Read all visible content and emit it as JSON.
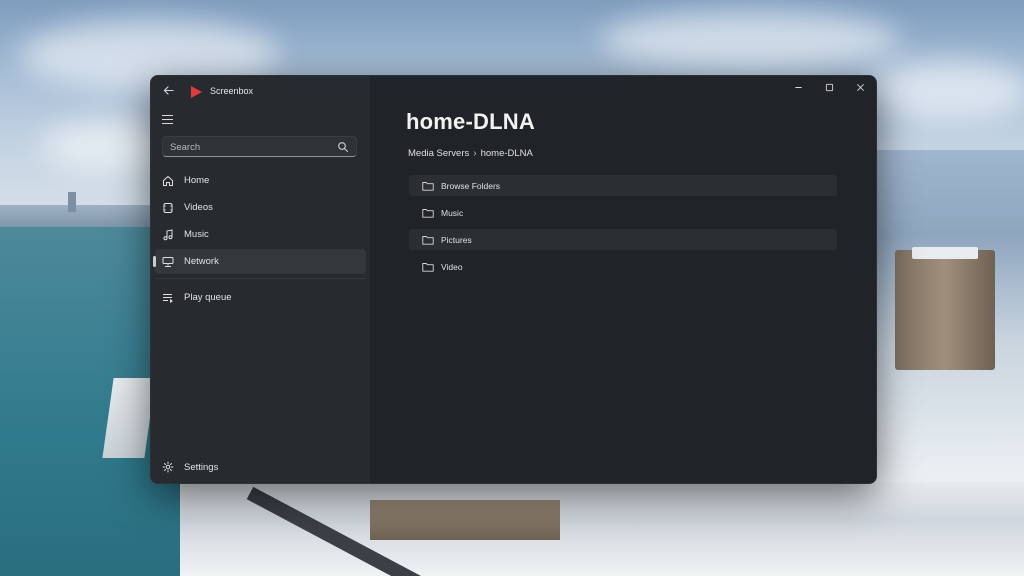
{
  "app": {
    "title": "Screenbox",
    "logo_color": "#e23a3a",
    "window_controls": [
      "minimize-icon",
      "maximize-icon",
      "close-icon"
    ]
  },
  "search": {
    "placeholder": "Search",
    "value": ""
  },
  "sidebar": {
    "items": [
      {
        "label": "Home",
        "icon": "home-icon",
        "active": false
      },
      {
        "label": "Videos",
        "icon": "video-icon",
        "active": false
      },
      {
        "label": "Music",
        "icon": "music-note-icon",
        "active": false
      },
      {
        "label": "Network",
        "icon": "network-icon",
        "active": true
      },
      {
        "label": "Play queue",
        "icon": "play-queue-icon",
        "active": false
      }
    ],
    "settings_label": "Settings"
  },
  "main": {
    "title": "home-DLNA",
    "breadcrumb": [
      "Media Servers",
      "home-DLNA"
    ],
    "folders": [
      {
        "label": "Browse Folders",
        "icon": "folder-icon"
      },
      {
        "label": "Music",
        "icon": "folder-icon"
      },
      {
        "label": "Pictures",
        "icon": "folder-icon"
      },
      {
        "label": "Video",
        "icon": "folder-icon"
      }
    ]
  },
  "colors": {
    "window_bg": "#202327",
    "sidebar_bg": "#272a2e",
    "accent": "#e23a3a"
  }
}
